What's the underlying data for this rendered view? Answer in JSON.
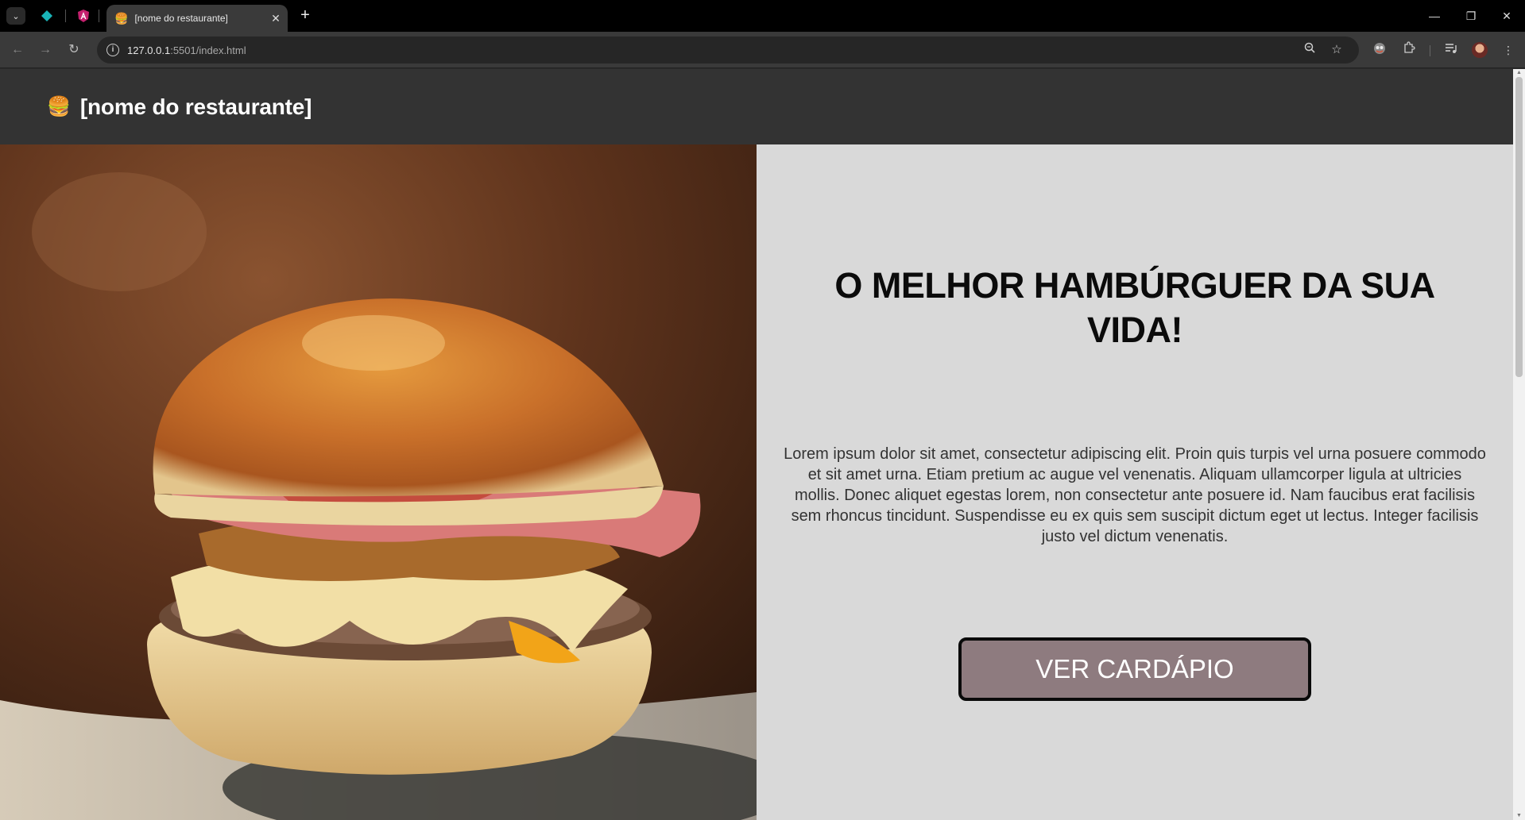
{
  "browser": {
    "tab": {
      "favicon": "burger-emoji",
      "title": "[nome do restaurante]",
      "close_glyph": "✕"
    },
    "new_tab_glyph": "+",
    "window_controls": {
      "minimize": "—",
      "restore": "❐",
      "close": "✕"
    },
    "address": {
      "host": "127.0.0.1",
      "rest": ":5501/index.html"
    }
  },
  "site": {
    "brand_icon": "🍔",
    "brand_name": "[nome do restaurante]"
  },
  "hero": {
    "image_name": "burger-photo",
    "headline": "O MELHOR HAMBÚRGUER DA SUA VIDA!",
    "description": "Lorem ipsum dolor sit amet, consectetur adipiscing elit. Proin quis turpis vel urna posuere commodo et sit amet urna. Etiam pretium ac augue vel venenatis. Aliquam ullamcorper ligula at ultricies mollis. Donec aliquet egestas lorem, non consectetur ante posuere id. Nam faucibus erat facilisis sem rhoncus tincidunt. Suspendisse eu ex quis sem suscipit dictum eget ut lectus. Integer facilisis justo vel dictum venenatis.",
    "cta_label": "VER CARDÁPIO"
  },
  "colors": {
    "header_bg": "#333333",
    "hero_right_bg": "#d9d9d9",
    "cta_bg": "#8e7b7f",
    "cta_border": "#0a0a0a"
  }
}
